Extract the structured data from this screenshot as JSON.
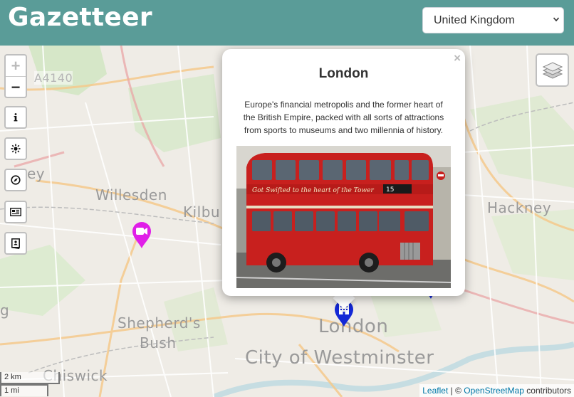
{
  "header": {
    "title": "Gazetteer",
    "country_select": {
      "selected": "United Kingdom"
    }
  },
  "map": {
    "places": {
      "willesden": "Willesden",
      "kilburn": "Kilbu",
      "hackney": "Hackney",
      "shepherds_bush_1": "Shepherd's",
      "shepherds_bush_2": "Bush",
      "london": "London",
      "westminster": "City of Westminster",
      "chiswick": "Chiswick",
      "road_a4140": "A4140",
      "edge_ey": "ey",
      "edge_g": "g"
    },
    "controls": {
      "zoom_in": "+",
      "zoom_out": "−"
    },
    "scale": {
      "km": "2 km",
      "mi": "1 mi"
    },
    "attribution": {
      "leaflet": "Leaflet",
      "sep": " | © ",
      "osm": "OpenStreetMap",
      "suffix": " contributors"
    }
  },
  "popup": {
    "close": "×",
    "title": "London",
    "description": "Europe's financial metropolis and the former heart of the British Empire, packed with all sorts of attractions from sports to museums and two millennia of history.",
    "photo_caption": "Red double-decker bus"
  },
  "bus_texts": {
    "route": "15",
    "ad": "Got Swifted to the heart of the Tower"
  },
  "colors": {
    "header_bg": "#5a9c98",
    "marker_magenta": "#e01ee8",
    "marker_blue": "#1428d6",
    "bus_red": "#c8201e"
  },
  "icons": [
    "info-icon",
    "sun-icon",
    "compass-icon",
    "news-icon",
    "book-icon",
    "layers-icon",
    "video-marker-icon",
    "building-marker-icon"
  ]
}
